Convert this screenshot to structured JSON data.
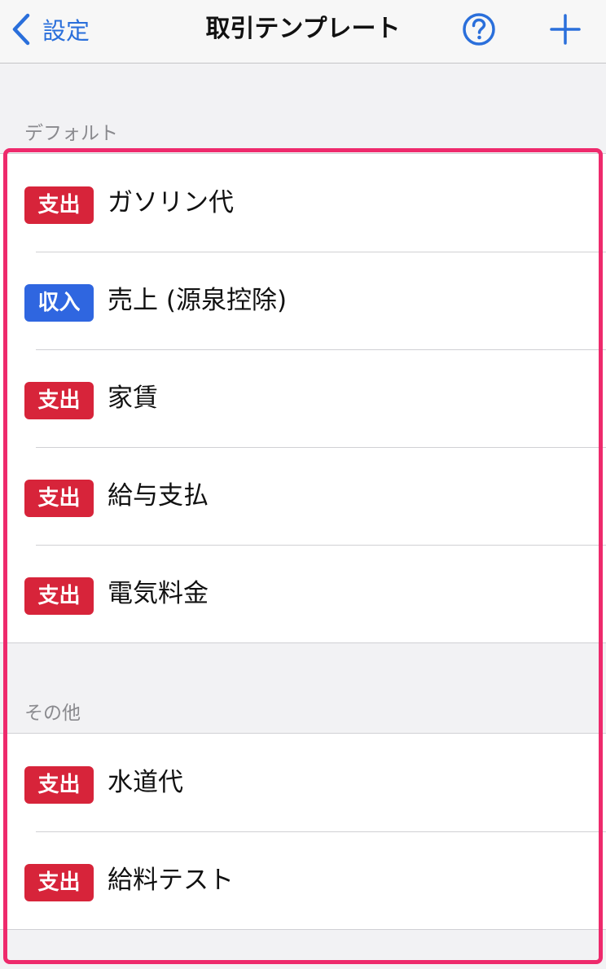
{
  "nav": {
    "back_label": "設定",
    "title": "取引テンプレート",
    "help_icon": "question-circle-icon",
    "add_icon": "plus-icon",
    "accent_color": "#2a6fdb"
  },
  "sections": [
    {
      "header": "デフォルト",
      "items": [
        {
          "type": "支出",
          "type_color": "#d7243a",
          "label": "ガソリン代"
        },
        {
          "type": "収入",
          "type_color": "#2f66e0",
          "label": "売上 (源泉控除)"
        },
        {
          "type": "支出",
          "type_color": "#d7243a",
          "label": "家賃"
        },
        {
          "type": "支出",
          "type_color": "#d7243a",
          "label": "給与支払"
        },
        {
          "type": "支出",
          "type_color": "#d7243a",
          "label": "電気料金"
        }
      ]
    },
    {
      "header": "その他",
      "items": [
        {
          "type": "支出",
          "type_color": "#d7243a",
          "label": "水道代"
        },
        {
          "type": "支出",
          "type_color": "#d7243a",
          "label": "給料テスト"
        }
      ]
    }
  ],
  "highlight_color": "#ee2a6c"
}
